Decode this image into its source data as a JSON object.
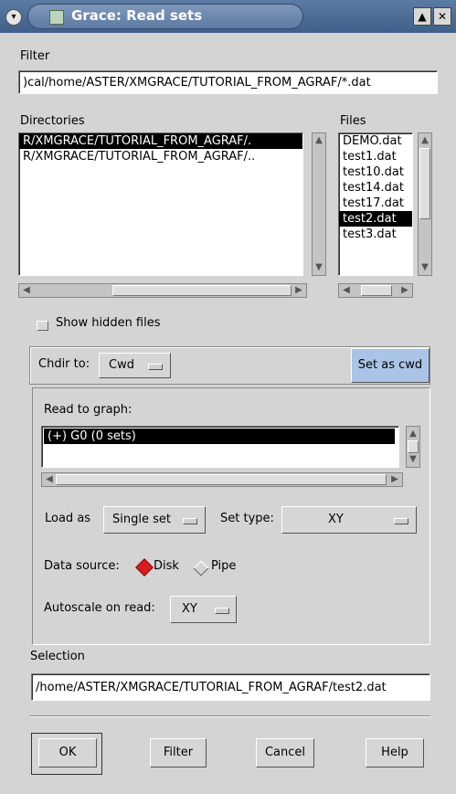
{
  "window": {
    "title": "Grace: Read sets",
    "menu_glyph": "▾",
    "maximize_glyph": "▲",
    "close_glyph": "✕"
  },
  "filter": {
    "label": "Filter",
    "value": ")cal/home/ASTER/XMGRACE/TUTORIAL_FROM_AGRAF/*.dat"
  },
  "directories": {
    "label": "Directories",
    "items": [
      {
        "text": "R/XMGRACE/TUTORIAL_FROM_AGRAF/.",
        "selected": true
      },
      {
        "text": "R/XMGRACE/TUTORIAL_FROM_AGRAF/..",
        "selected": false
      }
    ]
  },
  "files": {
    "label": "Files",
    "items": [
      {
        "text": "DEMO.dat",
        "selected": false
      },
      {
        "text": "test1.dat",
        "selected": false
      },
      {
        "text": "test10.dat",
        "selected": false
      },
      {
        "text": "test14.dat",
        "selected": false
      },
      {
        "text": "test17.dat",
        "selected": false
      },
      {
        "text": "test2.dat",
        "selected": true
      },
      {
        "text": "test3.dat",
        "selected": false
      }
    ]
  },
  "show_hidden": {
    "label": "Show hidden files",
    "checked": false
  },
  "chdir": {
    "label": "Chdir to:",
    "value": "Cwd",
    "set_cwd_label": "Set as cwd"
  },
  "read_to_graph": {
    "label": "Read to graph:",
    "items": [
      {
        "text": "(+) G0 (0 sets)",
        "selected": true
      }
    ]
  },
  "load_as": {
    "label": "Load as",
    "value": "Single set"
  },
  "set_type": {
    "label": "Set type:",
    "value": "XY"
  },
  "data_source": {
    "label": "Data source:",
    "options": [
      {
        "text": "Disk",
        "selected": true
      },
      {
        "text": "Pipe",
        "selected": false
      }
    ]
  },
  "autoscale": {
    "label": "Autoscale on read:",
    "value": "XY"
  },
  "selection": {
    "label": "Selection",
    "value": "/home/ASTER/XMGRACE/TUTORIAL_FROM_AGRAF/test2.dat"
  },
  "buttons": {
    "ok": "OK",
    "filter": "Filter",
    "cancel": "Cancel",
    "help": "Help"
  },
  "colors": {
    "titlebar": "#4a6a95",
    "selection_bg": "#000000",
    "set_cwd_bg": "#a9c4e6",
    "radio_on": "#d62020"
  }
}
